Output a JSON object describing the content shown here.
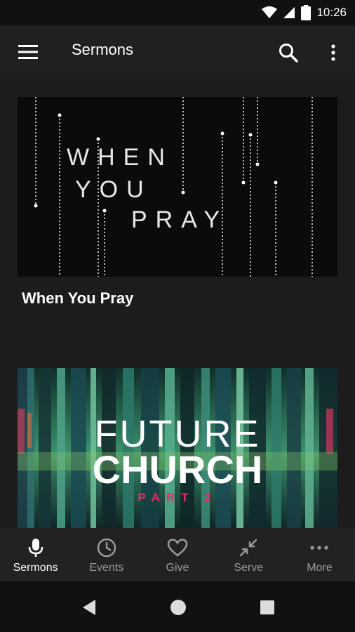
{
  "status_bar": {
    "time": "10:26"
  },
  "app_bar": {
    "title": "Sermons"
  },
  "sermons": [
    {
      "title": "When You Pray",
      "art_lines": [
        "WHEN",
        "YOU",
        "PRAY"
      ]
    },
    {
      "art_lines": [
        "FUTURE",
        "CHURCH",
        "PART 2"
      ]
    }
  ],
  "bottom_nav": [
    {
      "label": "Sermons",
      "icon": "microphone-icon",
      "active": true
    },
    {
      "label": "Events",
      "icon": "clock-icon",
      "active": false
    },
    {
      "label": "Give",
      "icon": "heart-icon",
      "active": false
    },
    {
      "label": "Serve",
      "icon": "arrows-inward-icon",
      "active": false
    },
    {
      "label": "More",
      "icon": "dots-horizontal-icon",
      "active": false
    }
  ],
  "colors": {
    "background": "#1c1c1c",
    "app_bar": "#202020",
    "active": "#ffffff",
    "inactive": "#9a9a9a",
    "accent_pink": "#e0306a"
  }
}
